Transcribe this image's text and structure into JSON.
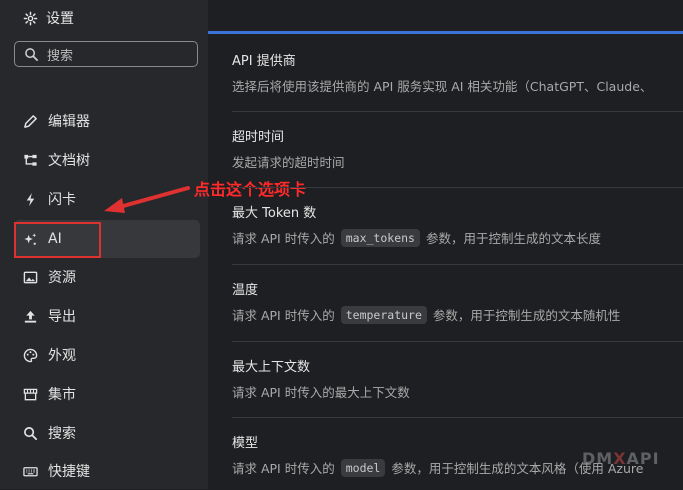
{
  "sidebar": {
    "title": "设置",
    "search_placeholder": "搜索",
    "items": [
      {
        "label": "编辑器",
        "icon": "pencil-icon"
      },
      {
        "label": "文档树",
        "icon": "tree-icon"
      },
      {
        "label": "闪卡",
        "icon": "lightning-icon"
      },
      {
        "label": "AI",
        "icon": "sparkle-icon"
      },
      {
        "label": "资源",
        "icon": "image-icon"
      },
      {
        "label": "导出",
        "icon": "upload-icon"
      },
      {
        "label": "外观",
        "icon": "palette-icon"
      },
      {
        "label": "集市",
        "icon": "store-icon"
      },
      {
        "label": "搜索",
        "icon": "search-icon"
      },
      {
        "label": "快捷键",
        "icon": "keyboard-icon"
      }
    ],
    "active_index": 3
  },
  "annotation": {
    "text": "点击这个选项卡",
    "color": "#ff2a2a"
  },
  "settings": [
    {
      "label": "API 提供商",
      "desc": "选择后将使用该提供商的 API 服务实现 AI 相关功能（ChatGPT、Claude、"
    },
    {
      "label": "超时时间",
      "desc": "发起请求的超时时间"
    },
    {
      "label": "最大 Token 数",
      "desc_pre": "请求 API 时传入的",
      "code": "max_tokens",
      "desc_post": "参数，用于控制生成的文本长度"
    },
    {
      "label": "温度",
      "desc_pre": "请求 API 时传入的",
      "code": "temperature",
      "desc_post": "参数，用于控制生成的文本随机性"
    },
    {
      "label": "最大上下文数",
      "desc": "请求 API 时传入的最大上下文数"
    },
    {
      "label": "模型",
      "desc_pre": "请求 API 时传入的",
      "code": "model",
      "desc_post": "参数，用于控制生成的文本风格（使用 Azure"
    }
  ],
  "watermark": {
    "part1": "DM",
    "part2": "X",
    "part3": "API"
  },
  "colors": {
    "accent": "#3b73d8",
    "background": "#1e1f22",
    "sidebar": "#27282b"
  }
}
